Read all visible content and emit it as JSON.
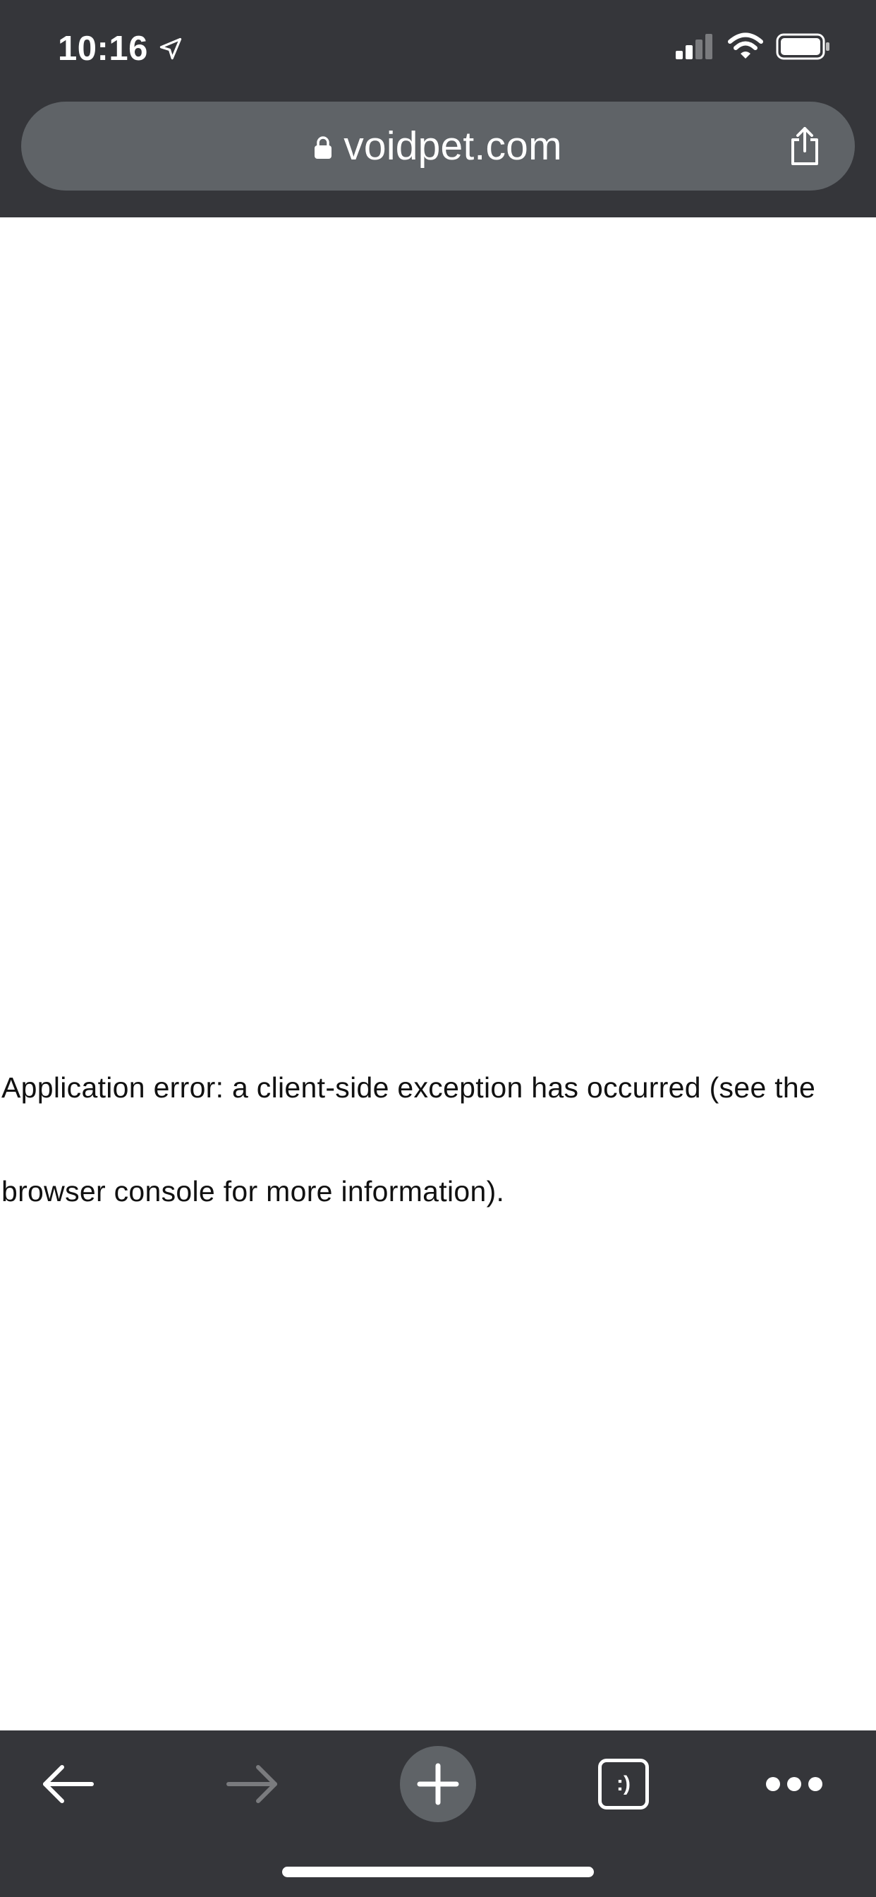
{
  "status_bar": {
    "time": "10:16",
    "icons": [
      "location-arrow-icon",
      "cellular-signal-icon",
      "wifi-icon",
      "battery-icon"
    ]
  },
  "address_bar": {
    "url": "voidpet.com",
    "secure_icon": "lock-icon",
    "share_icon": "share-icon"
  },
  "page": {
    "error_message": "Application error: a client-side exception has occurred (see the browser console for more information)."
  },
  "toolbar": {
    "items": [
      {
        "name": "back",
        "icon": "arrow-left-icon",
        "enabled": true
      },
      {
        "name": "forward",
        "icon": "arrow-right-icon",
        "enabled": false
      },
      {
        "name": "new-tab",
        "icon": "plus-icon",
        "enabled": true
      },
      {
        "name": "tab-switcher",
        "icon": "tabs-icon",
        "enabled": true
      },
      {
        "name": "more",
        "icon": "more-dots-icon",
        "enabled": true
      }
    ],
    "tab_switcher_label": ":)"
  },
  "colors": {
    "chrome_background": "#35363a",
    "url_bar_background": "#5f6367",
    "page_background": "#ffffff",
    "text": "#111111",
    "disabled_icon": "#7a7b7e"
  }
}
